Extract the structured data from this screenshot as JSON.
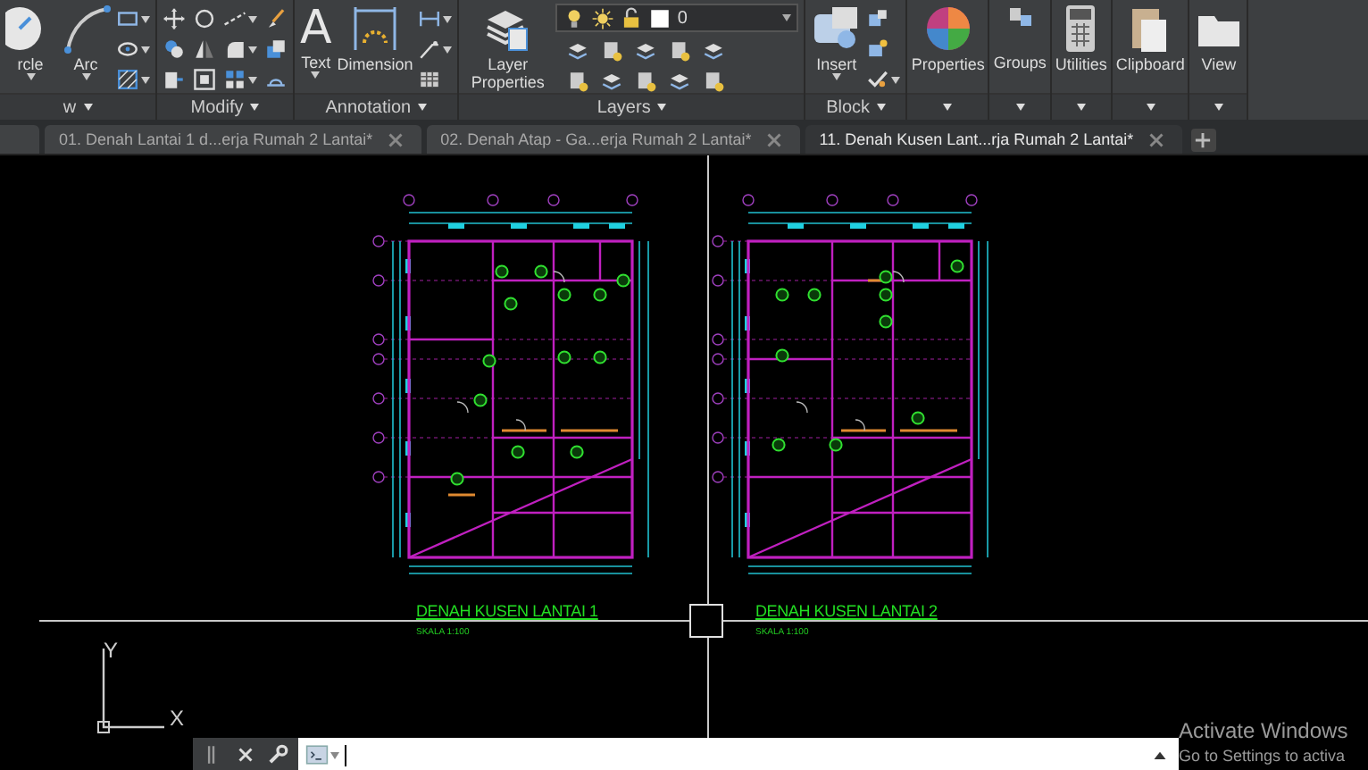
{
  "ribbon": {
    "panels": [
      {
        "kind": "draw",
        "title": "w",
        "buttons": [
          "rcle",
          "Arc"
        ]
      },
      {
        "kind": "modify",
        "title": "Modify"
      },
      {
        "kind": "annotation",
        "title": "Annotation",
        "buttons": [
          "Text",
          "Dimension"
        ],
        "glyph": "A"
      },
      {
        "kind": "layers",
        "title": "Layers",
        "buttons": [
          "Layer Properties"
        ],
        "layer_value": "0"
      },
      {
        "kind": "block",
        "title": "Block",
        "buttons": [
          "Insert"
        ]
      },
      {
        "kind": "properties",
        "buttons": [
          "Properties"
        ]
      },
      {
        "kind": "groups",
        "buttons": [
          "Groups"
        ]
      },
      {
        "kind": "utilities",
        "buttons": [
          "Utilities"
        ]
      },
      {
        "kind": "clipboard",
        "buttons": [
          "Clipboard"
        ]
      },
      {
        "kind": "view",
        "buttons": [
          "View"
        ]
      }
    ]
  },
  "file_tabs": [
    {
      "label": "01. Denah Lantai 1 d...erja Rumah 2 Lantai*",
      "selected": false
    },
    {
      "label": "02. Denah Atap - Ga...erja Rumah 2 Lantai*",
      "selected": false
    },
    {
      "label": "11. Denah Kusen Lant...rja Rumah 2 Lantai*",
      "selected": true
    }
  ],
  "drawing": {
    "plans": [
      {
        "title": "DENAH KUSEN LANTAI 1",
        "scale": "SKALA 1:100"
      },
      {
        "title": "DENAH KUSEN LANTAI 2",
        "scale": "SKALA 1:100"
      }
    ],
    "ucs": {
      "y_label": "Y",
      "x_label": "X"
    }
  },
  "overlay": {
    "title": "Activate Windows",
    "subtitle": "Go to Settings to activa"
  }
}
